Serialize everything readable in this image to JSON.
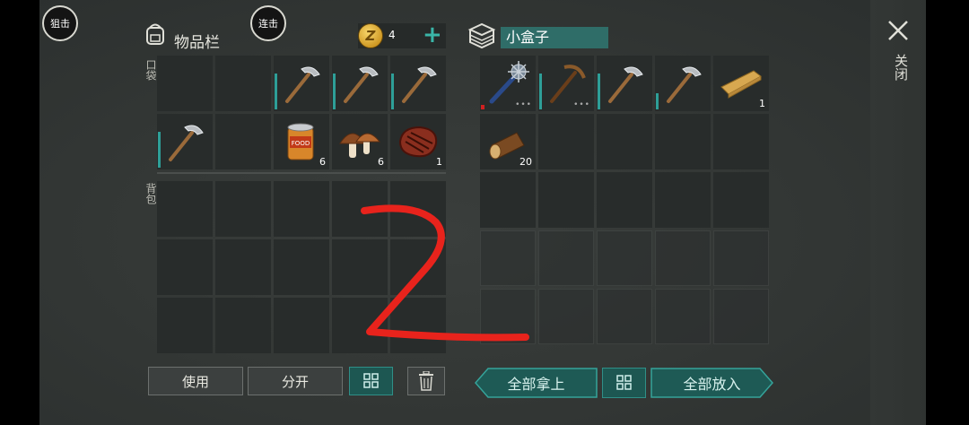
{
  "top_buttons": {
    "snipe": "狙击",
    "combo": "连击"
  },
  "inventory": {
    "title": "物品栏",
    "coins": "4",
    "pocket_label": "口袋",
    "backpack_label": "背包",
    "pocket_slots": [
      {
        "item": ""
      },
      {
        "item": ""
      },
      {
        "item": "pickaxe",
        "durability": "full"
      },
      {
        "item": "pickaxe",
        "durability": "full"
      },
      {
        "item": "pickaxe",
        "durability": "full"
      },
      {
        "item": "pickaxe",
        "durability": "full"
      },
      {
        "item": ""
      },
      {
        "item": "canned-food",
        "count": "6",
        "label": "FOOD"
      },
      {
        "item": "mushrooms",
        "count": "6"
      },
      {
        "item": "steak",
        "count": "1"
      }
    ]
  },
  "box": {
    "name": "小盒子",
    "slots": [
      {
        "item": "spiked-club",
        "dots": "•••",
        "red": true
      },
      {
        "item": "pickaxe-wood",
        "durability": "full",
        "dots": "•••"
      },
      {
        "item": "pickaxe",
        "durability": "full"
      },
      {
        "item": "pickaxe",
        "durability": "short"
      },
      {
        "item": "plank",
        "count": "1"
      },
      {
        "item": "log",
        "count": "20"
      }
    ]
  },
  "buttons": {
    "use": "使用",
    "split": "分开",
    "take_all": "全部拿上",
    "put_all": "全部放入",
    "close": "关闭"
  },
  "annotation": {
    "glyph": "2",
    "color": "#e8231c"
  },
  "colors": {
    "accent": "#2f8f87",
    "slot_bg": "#282c2b",
    "panel_bg": "#343836"
  }
}
